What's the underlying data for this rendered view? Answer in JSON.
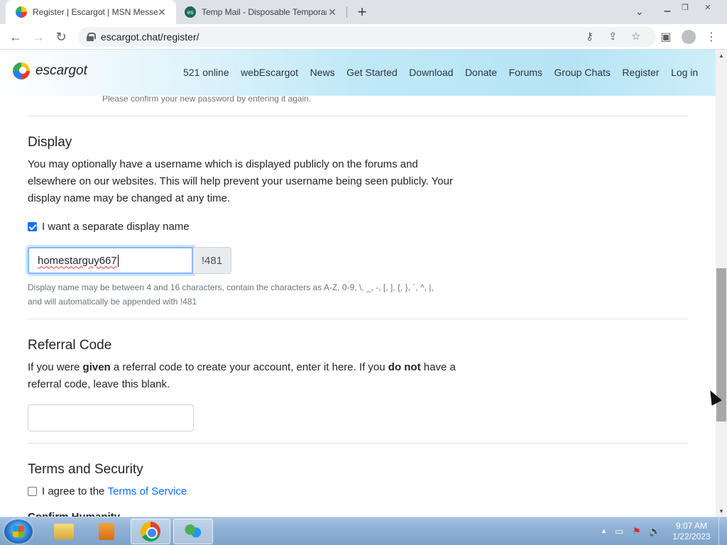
{
  "browser": {
    "tabs": [
      {
        "title": "Register | Escargot | MSN Messenger",
        "active": true
      },
      {
        "title": "Temp Mail - Disposable Temporary Email",
        "active": false
      }
    ],
    "favicon_text_tab2": "es",
    "url": "escargot.chat/register/"
  },
  "site": {
    "logo_text": "escargot",
    "nav": [
      "521 online",
      "webEscargot",
      "News",
      "Get Started",
      "Download",
      "Donate",
      "Forums",
      "Group Chats",
      "Register",
      "Log in"
    ]
  },
  "form": {
    "password_hint": "Please confirm your new password by entering it again.",
    "display": {
      "heading": "Display",
      "description": "You may optionally have a username which is displayed publicly on the forums and elsewhere on our websites. This will help prevent your username being seen publicly. Your display name may be changed at any time.",
      "checkbox_label": "I want a separate display name",
      "checkbox_checked": true,
      "name_value": "homestarguy667",
      "suffix": "!481",
      "help_line1": "Display name may be between 4 and 16 characters, contain the characters as A-Z, 0-9, \\, _, -, [, ], {, }, `, ^, |,",
      "help_line2": "and will automatically be appended with !481"
    },
    "referral": {
      "heading": "Referral Code",
      "text_1": "If you were ",
      "text_given": "given",
      "text_2": " a referral code to create your account, enter it here. If you ",
      "text_donot": "do not",
      "text_3": " have a referral code, leave this blank.",
      "value": ""
    },
    "terms": {
      "heading": "Terms and Security",
      "agree_prefix": "I agree to the ",
      "agree_link": "Terms of Service",
      "agree_checked": false,
      "next_label_partial": "Confirm Humanity"
    }
  },
  "taskbar": {
    "time": "9:07 AM",
    "date": "1/22/2023"
  }
}
